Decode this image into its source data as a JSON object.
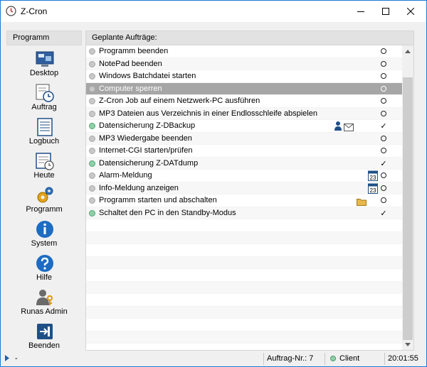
{
  "window": {
    "title": "Z-Cron"
  },
  "sidebar": {
    "header": "Programm",
    "items": [
      {
        "label": "Desktop",
        "icon": "desktop-icon"
      },
      {
        "label": "Auftrag",
        "icon": "job-clock-icon"
      },
      {
        "label": "Logbuch",
        "icon": "logbook-icon"
      },
      {
        "label": "Heute",
        "icon": "today-calendar-icon"
      },
      {
        "label": "Programm",
        "icon": "gears-icon"
      },
      {
        "label": "System",
        "icon": "info-icon"
      },
      {
        "label": "Hilfe",
        "icon": "help-icon"
      },
      {
        "label": "Runas Admin",
        "icon": "admin-user-key-icon"
      },
      {
        "label": "Beenden",
        "icon": "exit-icon"
      }
    ]
  },
  "main": {
    "header": "Geplante Aufträge:",
    "rows": [
      {
        "text": "Programm beenden",
        "status": "circle",
        "dot": "gray"
      },
      {
        "text": "NotePad beenden",
        "status": "circle",
        "dot": "gray"
      },
      {
        "text": "Windows Batchdatei starten",
        "status": "circle",
        "dot": "gray"
      },
      {
        "text": "Computer sperren",
        "status": "circle",
        "dot": "gray",
        "selected": true
      },
      {
        "text": "Z-Cron Job auf einem Netzwerk-PC ausführen",
        "status": "circle",
        "dot": "gray"
      },
      {
        "text": "MP3 Dateien aus Verzeichnis in einer Endlosschleife abspielen",
        "status": "circle",
        "dot": "gray"
      },
      {
        "text": "Datensicherung Z-DBackup",
        "status": "✓",
        "dot": "green",
        "extras": [
          "user-icon",
          "mail-icon"
        ]
      },
      {
        "text": "MP3 Wiedergabe beenden",
        "status": "circle",
        "dot": "gray"
      },
      {
        "text": "Internet-CGI starten/prüfen",
        "status": "circle",
        "dot": "gray"
      },
      {
        "text": "Datensicherung Z-DATdump",
        "status": "✓",
        "dot": "green"
      },
      {
        "text": "Alarm-Meldung",
        "status": "circle",
        "dot": "gray",
        "extras": [
          "calendar-icon"
        ],
        "calendar_day": "23"
      },
      {
        "text": "Info-Meldung anzeigen",
        "status": "circle",
        "dot": "gray",
        "extras": [
          "calendar-icon"
        ],
        "calendar_day": "23"
      },
      {
        "text": "Programm starten und abschalten",
        "status": "circle",
        "dot": "gray",
        "extras": [
          "folder-icon"
        ]
      },
      {
        "text": "Schaltet den PC in den Standby-Modus",
        "status": "✓",
        "dot": "green"
      }
    ]
  },
  "statusbar": {
    "left": "-",
    "job_number": "Auftrag-Nr.: 7",
    "mode": "Client",
    "time": "20:01:55"
  },
  "colors": {
    "accent": "#1e78d6",
    "selected_row": "#a6a6a6",
    "active_dot": "#8fd0a8"
  }
}
